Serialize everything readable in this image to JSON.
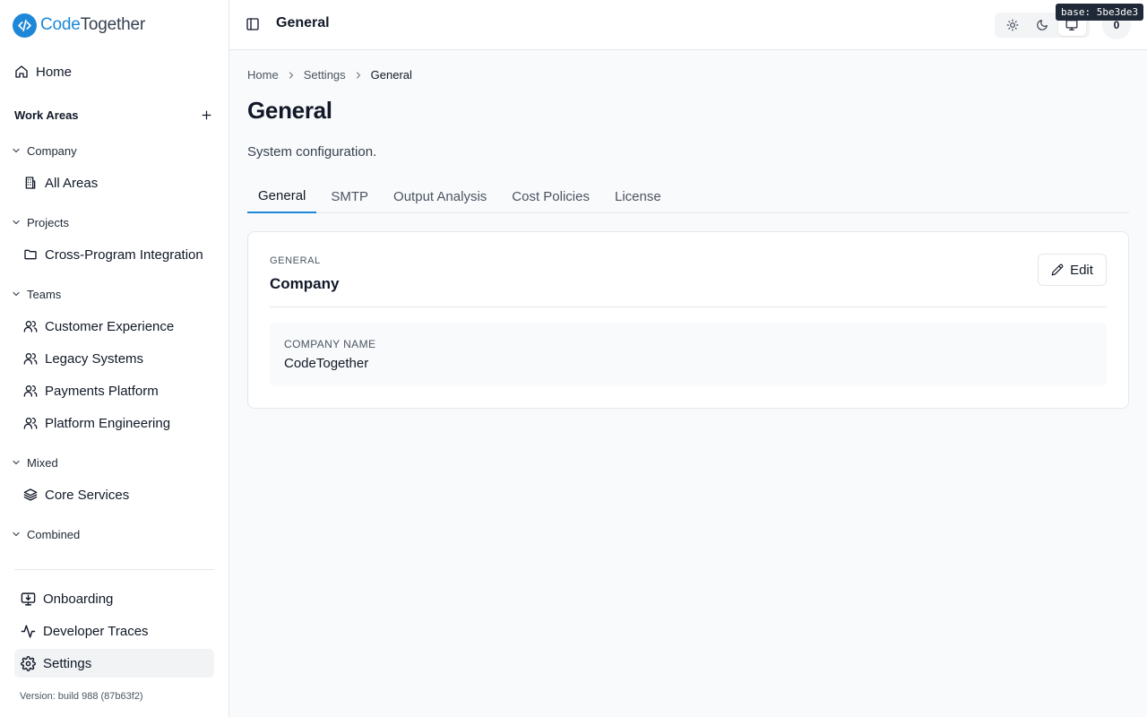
{
  "brand": {
    "name_part1": "Code",
    "name_part2": "Together",
    "color": "#1e88d8"
  },
  "sidebar": {
    "home_label": "Home",
    "work_areas_title": "Work Areas",
    "groups": [
      {
        "label": "Company",
        "items": [
          {
            "label": "All Areas",
            "icon": "building-icon"
          }
        ]
      },
      {
        "label": "Projects",
        "items": [
          {
            "label": "Cross-Program Integration",
            "icon": "folder-icon"
          }
        ]
      },
      {
        "label": "Teams",
        "items": [
          {
            "label": "Customer Experience",
            "icon": "users-icon"
          },
          {
            "label": "Legacy Systems",
            "icon": "users-icon"
          },
          {
            "label": "Payments Platform",
            "icon": "users-icon"
          },
          {
            "label": "Platform Engineering",
            "icon": "users-icon"
          }
        ]
      },
      {
        "label": "Mixed",
        "items": [
          {
            "label": "Core Services",
            "icon": "layers-icon"
          }
        ]
      },
      {
        "label": "Combined",
        "items": []
      }
    ],
    "bottom_items": [
      {
        "label": "Onboarding",
        "icon": "monitor-download-icon"
      },
      {
        "label": "Developer Traces",
        "icon": "activity-icon"
      },
      {
        "label": "Settings",
        "icon": "gear-icon",
        "active": true
      }
    ],
    "version": "Version: build 988 (87b63f2)"
  },
  "topbar": {
    "title": "General",
    "theme_options": [
      "sun-icon",
      "moon-icon",
      "monitor-icon"
    ],
    "theme_selected": "monitor-icon",
    "avatar_text": "0",
    "build_badge": "base: 5be3de3"
  },
  "breadcrumb": {
    "items": [
      "Home",
      "Settings"
    ],
    "current": "General"
  },
  "page": {
    "title": "General",
    "description": "System configuration.",
    "tabs": [
      "General",
      "SMTP",
      "Output Analysis",
      "Cost Policies",
      "License"
    ],
    "active_tab": "General"
  },
  "card": {
    "eyebrow": "GENERAL",
    "title": "Company",
    "edit_label": "Edit",
    "field_label": "COMPANY NAME",
    "field_value": "CodeTogether"
  }
}
